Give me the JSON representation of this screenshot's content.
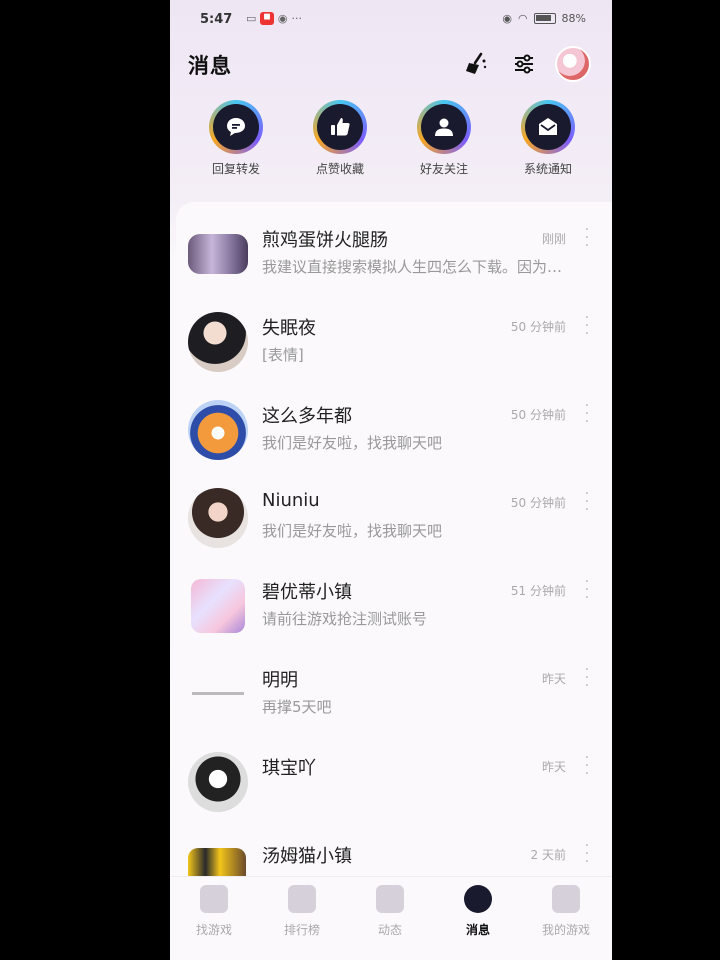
{
  "status_bar": {
    "time": "5:47",
    "battery": "88%"
  },
  "header": {
    "title": "消息"
  },
  "shortcuts": [
    {
      "label": "回复转发",
      "icon": "chat-bubble-icon"
    },
    {
      "label": "点赞收藏",
      "icon": "thumbs-up-icon"
    },
    {
      "label": "好友关注",
      "icon": "person-icon"
    },
    {
      "label": "系统通知",
      "icon": "envelope-icon"
    }
  ],
  "conversations": [
    {
      "name": "煎鸡蛋饼火腿肠",
      "preview": "我建议直接搜索模拟人生四怎么下载。因为…",
      "time": "刚刚"
    },
    {
      "name": "失眠夜",
      "preview": "[表情]",
      "time": "50 分钟前"
    },
    {
      "name": "这么多年都",
      "preview": "我们是好友啦，找我聊天吧",
      "time": "50 分钟前"
    },
    {
      "name": "Niuniu",
      "preview": "我们是好友啦，找我聊天吧",
      "time": "50 分钟前"
    },
    {
      "name": "碧优蒂小镇",
      "preview": "请前往游戏抢注测试账号",
      "time": "51 分钟前"
    },
    {
      "name": "明明",
      "preview": "再撑5天吧",
      "time": "昨天"
    },
    {
      "name": "琪宝吖",
      "preview": "",
      "time": "昨天"
    },
    {
      "name": "汤姆猫小镇",
      "preview": "",
      "time": "2 天前"
    }
  ],
  "tabs": [
    {
      "label": "找游戏"
    },
    {
      "label": "排行榜"
    },
    {
      "label": "动态"
    },
    {
      "label": "消息"
    },
    {
      "label": "我的游戏"
    }
  ]
}
